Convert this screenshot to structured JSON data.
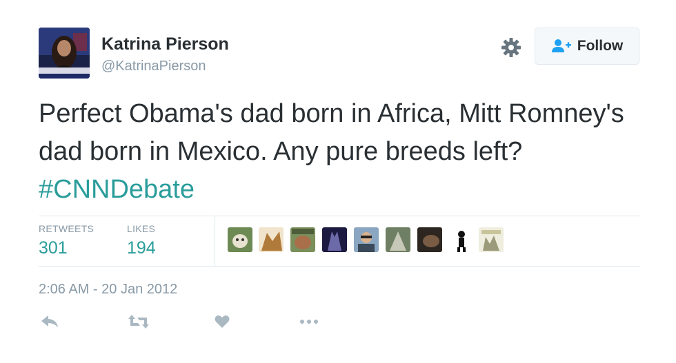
{
  "author": {
    "name": "Katrina Pierson",
    "handle": "@KatrinaPierson",
    "avatar_icon": "profile-photo",
    "avatar_banner_text": "KATRINA PIERSON"
  },
  "follow_button": {
    "label": "Follow",
    "icon": "add-user-icon"
  },
  "settings": {
    "icon": "gear-icon"
  },
  "tweet": {
    "text_before": "Perfect Obama's dad born in Africa, Mitt Romney's dad born in Mexico. Any pure breeds left? ",
    "hashtag": "#CNNDebate"
  },
  "stats": {
    "retweets_label": "RETWEETS",
    "retweets_count": "301",
    "likes_label": "LIKES",
    "likes_count": "194"
  },
  "likers": [
    {
      "name": "liker-avatar",
      "color": "#6d8a55"
    },
    {
      "name": "liker-avatar",
      "color": "#b07a3a"
    },
    {
      "name": "liker-avatar",
      "color": "#7a8f5c"
    },
    {
      "name": "liker-avatar",
      "color": "#3c3a78"
    },
    {
      "name": "liker-avatar",
      "color": "#4e6478"
    },
    {
      "name": "liker-avatar",
      "color": "#6f7f63"
    },
    {
      "name": "liker-avatar",
      "color": "#5b4a3b"
    },
    {
      "name": "liker-avatar",
      "color": "#ffffff"
    },
    {
      "name": "liker-avatar",
      "color": "#d8d4b8"
    }
  ],
  "timestamp": "2:06 AM - 20 Jan 2012",
  "actions": [
    {
      "name": "reply-icon"
    },
    {
      "name": "retweet-icon"
    },
    {
      "name": "like-icon"
    },
    {
      "name": "more-icon"
    }
  ],
  "colors": {
    "accent": "#2a9d9b",
    "muted": "#8899a6",
    "text": "#292f33",
    "follow_icon": "#1da1f2"
  }
}
